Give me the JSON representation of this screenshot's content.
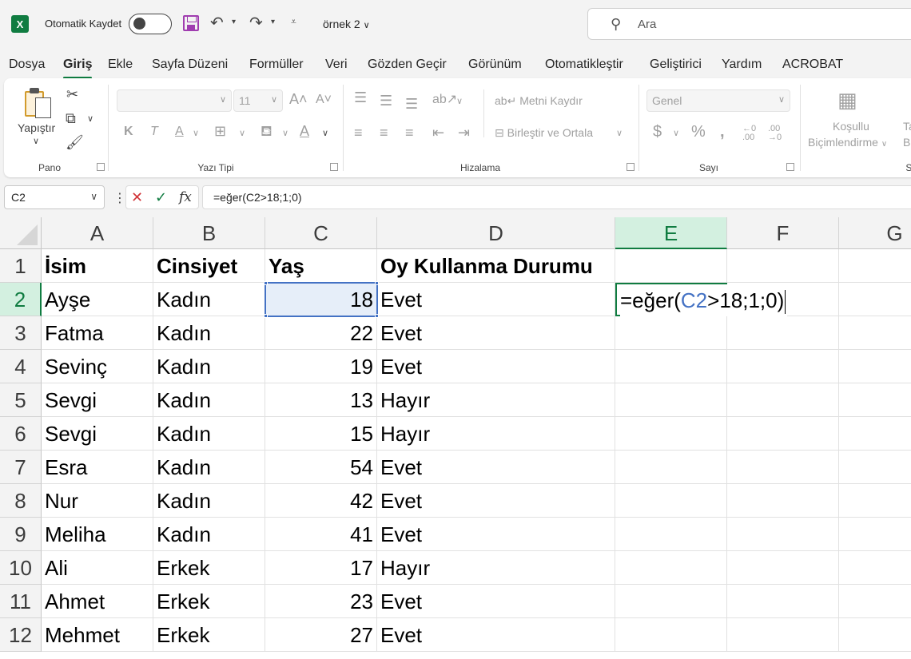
{
  "titlebar": {
    "autosave_label": "Otomatik Kaydet",
    "doc_name": "örnek 2",
    "search_placeholder": "Ara",
    "colors": {
      "excel_green": "#107c41",
      "save_purple": "#a03db0"
    }
  },
  "menu": {
    "items": [
      "Dosya",
      "Giriş",
      "Ekle",
      "Sayfa Düzeni",
      "Formüller",
      "Veri",
      "Gözden Geçir",
      "Görünüm",
      "Otomatikleştir",
      "Geliştirici",
      "Yardım",
      "ACROBAT"
    ],
    "active": "Giriş"
  },
  "ribbon": {
    "groups": {
      "pano": "Pano",
      "yazi_tipi": "Yazı Tipi",
      "hizalama": "Hizalama",
      "sayi": "Sayı"
    },
    "paste_label": "Yapıştır",
    "font_size": "11",
    "wrap_text": "Metni Kaydır",
    "merge_center": "Birleştir ve Ortala",
    "number_format": "Genel",
    "conditional_line1": "Koşullu",
    "conditional_line2": "Biçimlendirme",
    "bold_glyph": "K",
    "italic_glyph": "T",
    "underline_glyph": "A",
    "increase_decimal": ".00",
    "decrease_decimal": ".00",
    "partial_1": "Ta",
    "partial_2": "Bi",
    "partial_3": "St"
  },
  "formula_bar": {
    "name_box": "C2",
    "formula": "=eğer(C2>18;1;0)",
    "fx_glyph": "fx"
  },
  "sheet": {
    "columns": [
      "A",
      "B",
      "C",
      "D",
      "E",
      "F",
      "G"
    ],
    "selected_column": "E",
    "selected_row": "2",
    "active_cell_edit": {
      "prefix": "=eğer(",
      "ref": "C2",
      "suffix": ">18;1;0)"
    },
    "header_row": {
      "row": "1",
      "A": "İsim",
      "B": "Cinsiyet",
      "C": "Yaş",
      "D": "Oy Kullanma Durumu"
    },
    "rows": [
      {
        "row": "2",
        "A": "Ayşe",
        "B": "Kadın",
        "C": "18",
        "D": "Evet"
      },
      {
        "row": "3",
        "A": "Fatma",
        "B": "Kadın",
        "C": "22",
        "D": "Evet"
      },
      {
        "row": "4",
        "A": "Sevinç",
        "B": "Kadın",
        "C": "19",
        "D": "Evet"
      },
      {
        "row": "5",
        "A": "Sevgi",
        "B": "Kadın",
        "C": "13",
        "D": "Hayır"
      },
      {
        "row": "6",
        "A": "Sevgi",
        "B": "Kadın",
        "C": "15",
        "D": "Hayır"
      },
      {
        "row": "7",
        "A": "Esra",
        "B": "Kadın",
        "C": "54",
        "D": "Evet"
      },
      {
        "row": "8",
        "A": "Nur",
        "B": "Kadın",
        "C": "42",
        "D": "Evet"
      },
      {
        "row": "9",
        "A": "Meliha",
        "B": "Kadın",
        "C": "41",
        "D": "Evet"
      },
      {
        "row": "10",
        "A": "Ali",
        "B": "Erkek",
        "C": "17",
        "D": "Hayır"
      },
      {
        "row": "11",
        "A": "Ahmet",
        "B": "Erkek",
        "C": "23",
        "D": "Evet"
      },
      {
        "row": "12",
        "A": "Mehmet",
        "B": "Erkek",
        "C": "27",
        "D": "Evet"
      }
    ]
  }
}
